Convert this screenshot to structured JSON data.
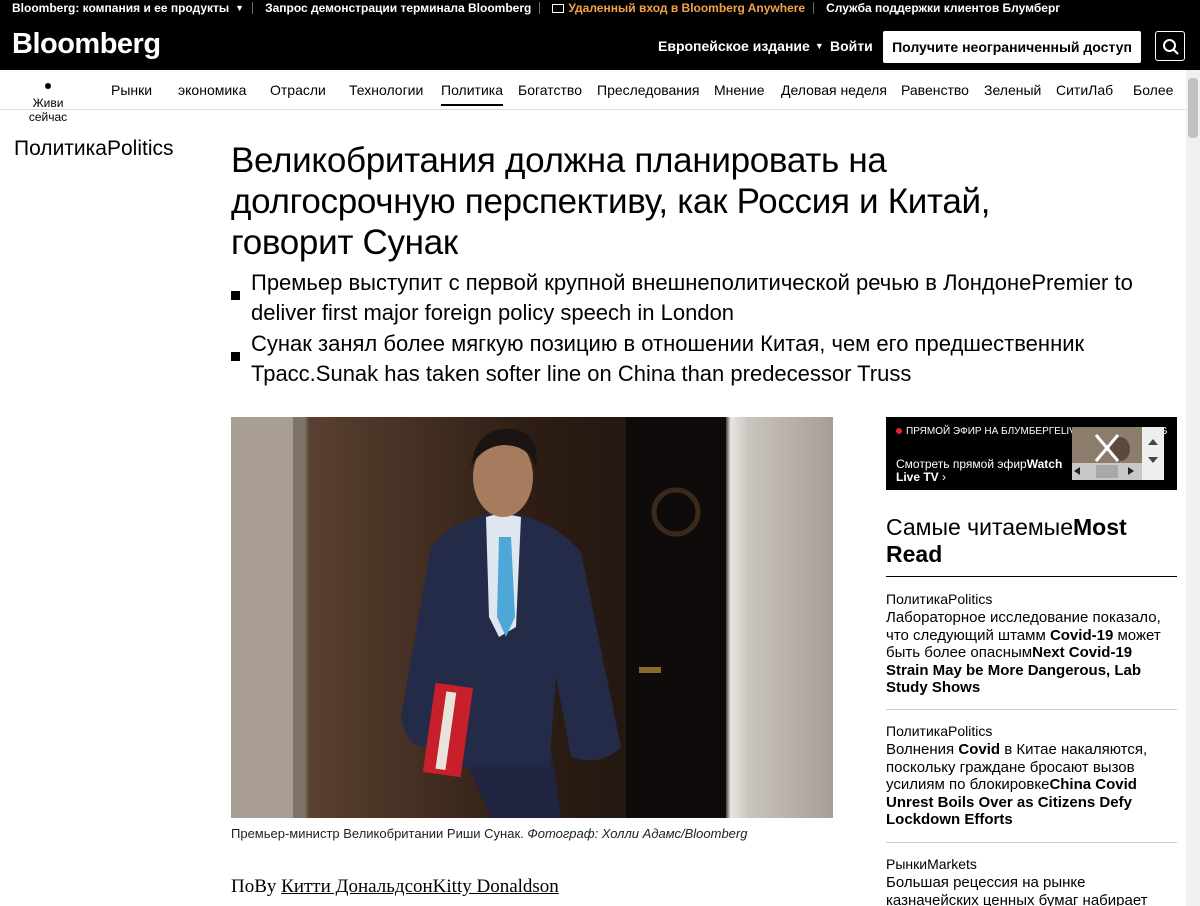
{
  "utilbar": {
    "company": "Bloomberg: компания и ее продукты",
    "demo": "Запрос демонстрации терминала Bloomberg",
    "remote": "Удаленный вход в Bloomberg Anywhere",
    "support": "Служба поддержки клиентов Блумберг"
  },
  "masthead": {
    "logo": "Bloomberg",
    "edition": "Европейское издание",
    "signin": "Войти",
    "subscribe": "Получите неограниченный доступ"
  },
  "nav": {
    "live": "Живи сейчас",
    "items": [
      "Рынки",
      "экономика",
      "Отрасли",
      "Технологии",
      "Политика",
      "Богатство",
      "Преследования",
      "Мнение",
      "Деловая неделя",
      "Равенство",
      "Зеленый",
      "СитиЛаб",
      "Более"
    ],
    "active": "Политика"
  },
  "article": {
    "section": "ПолитикаPolitics",
    "headline": "Великобритания должна планировать на долгосрочную перспективу, как Россия и Китай, говорит Сунак",
    "bullets": [
      "Премьер выступит с первой крупной внешнеполитической речью в ЛондонеPremier to deliver first major foreign policy speech in London",
      "Сунак занял более мягкую позицию в отношении Китая, чем его предшественник Трасс.Sunak has taken softer line on China than predecessor Truss"
    ],
    "caption": "Премьер-министр Великобритании Риши Сунак.",
    "caption_credit": "Фотограф: Холли Адамс/Bloomberg",
    "byline_prefix": "ПоBy",
    "byline_author": "Китти ДональдсонKitty Donaldson"
  },
  "livetv": {
    "label": "ПРЯМОЙ ЭФИР НА БЛУМБЕРГЕLIVE ON BLOOMBERG",
    "watch_ru": "Смотреть прямой эфир",
    "watch_en": "Watch Live TV"
  },
  "mostread": {
    "title_ru": "Самые читаемые",
    "title_en": "Most Read",
    "items": [
      {
        "category": "ПолитикаPolitics",
        "text_ru": "Лабораторное исследование показало, что следующий штамм ",
        "text_ru_b": "Covid-19",
        "text_ru2": " может быть более опасным",
        "text_en": "Next Covid-19 Strain May be More Dangerous, Lab Study Shows"
      },
      {
        "category": "ПолитикаPolitics",
        "text_ru": "Волнения ",
        "text_ru_b": "Covid",
        "text_ru2": " в Китае накаляются, поскольку граждане бросают вызов усилиям по блокировке",
        "text_en": "China Covid Unrest Boils Over as Citizens Defy Lockdown Efforts"
      },
      {
        "category": "РынкиMarkets",
        "text_ru": "Большая рецессия на рынке казначейских ценных бумаг набирает",
        "text_ru_b": "",
        "text_ru2": "",
        "text_en": ""
      }
    ]
  },
  "colors": {
    "black": "#000000",
    "remote_orange": "#f3a24a",
    "live_red": "#e0262d"
  }
}
